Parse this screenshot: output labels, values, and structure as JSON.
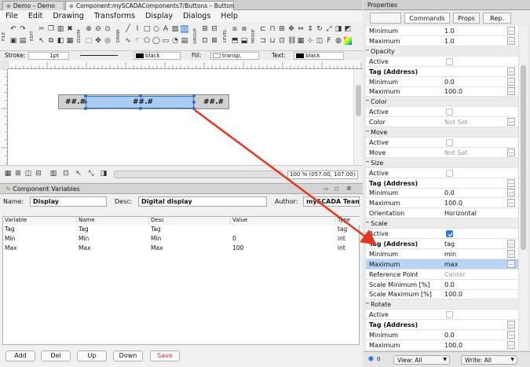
{
  "tabs": [
    {
      "label": "Demo – Demo"
    },
    {
      "label": "Component:mySCADAComponents7/Buttons – Button"
    }
  ],
  "menu": [
    "File",
    "Edit",
    "Drawing",
    "Transforms",
    "Display",
    "Dialogs",
    "Help"
  ],
  "toolbar": {
    "groups": [
      "FILE",
      "EDIT",
      "ZOOM",
      "DRAW",
      "GROUP",
      "LEVEL",
      "MODIF"
    ]
  },
  "propbar": {
    "stroke_label": "Stroke:",
    "stroke_value": "1pt",
    "stroke_color": "black",
    "fill_label": "Fill:",
    "fill_value": "transp.",
    "text_label": "Text:",
    "text_color": "black"
  },
  "canvas": {
    "left_text": "##.#",
    "center_text": "##.#",
    "right_text": "##.#"
  },
  "bottombar": {
    "zoom": "100 % (057.00, 107.00)"
  },
  "component_variables": {
    "title": "Component Variables",
    "name_label": "Name:",
    "name_value": "Display",
    "desc_label": "Desc:",
    "desc_value": "Digital display",
    "author_label": "Author:",
    "author_value": "mySCADA Team",
    "columns": [
      "Variable",
      "Name",
      "Desc",
      "Value",
      "Type"
    ],
    "rows": [
      {
        "variable": "Tag",
        "name": "Tag",
        "desc": "Tag",
        "value": "",
        "type": "tag"
      },
      {
        "variable": "Min",
        "name": "Min",
        "desc": "Min",
        "value": "0",
        "type": "int"
      },
      {
        "variable": "Max",
        "name": "Max",
        "desc": "Max",
        "value": "100",
        "type": "int"
      }
    ],
    "buttons": {
      "add": "Add",
      "del": "Del",
      "up": "Up",
      "down": "Down",
      "save": "Save"
    }
  },
  "properties": {
    "title": "Properties",
    "tabs": [
      "Commands",
      "Props",
      "Rep."
    ],
    "rows": [
      {
        "k": "Minimum",
        "v": "1.0",
        "dots": true
      },
      {
        "k": "Maximum",
        "v": "1.0",
        "dots": true
      },
      {
        "k": "Opacity",
        "section": true
      },
      {
        "k": "Active",
        "check": false
      },
      {
        "k": "Tag (Address)",
        "bold": true,
        "v": "",
        "dots": true
      },
      {
        "k": "Minimum",
        "v": "0.0",
        "dots": true
      },
      {
        "k": "Maximum",
        "v": "100.0",
        "dots": true
      },
      {
        "k": "Color",
        "section": true
      },
      {
        "k": "Active",
        "check": false
      },
      {
        "k": "Color",
        "v": "Not Set",
        "grey": true,
        "dots": true
      },
      {
        "k": "Move",
        "section": true
      },
      {
        "k": "Active",
        "check": false
      },
      {
        "k": "Move",
        "v": "Not Set",
        "grey": true,
        "dots": true
      },
      {
        "k": "Size",
        "section": true
      },
      {
        "k": "Active",
        "check": false
      },
      {
        "k": "Tag (Address)",
        "bold": true,
        "v": "",
        "dots": true
      },
      {
        "k": "Minimum",
        "v": "0.0",
        "dots": true
      },
      {
        "k": "Maximum",
        "v": "100.0",
        "dots": true
      },
      {
        "k": "Orientation",
        "v": "Horizontal"
      },
      {
        "k": "Scale",
        "section": true
      },
      {
        "k": "Active",
        "check": true
      },
      {
        "k": "Tag (Address)",
        "bold": true,
        "v": "tag",
        "dots": true
      },
      {
        "k": "Minimum",
        "v": "min",
        "dots": true
      },
      {
        "k": "Maximum",
        "v": "max",
        "dots": true,
        "selected": true
      },
      {
        "k": "Reference Point",
        "v": "Center",
        "grey": true
      },
      {
        "k": "Scale Minimum [%]",
        "v": "0.0"
      },
      {
        "k": "Scale Maximum [%]",
        "v": "100.0"
      },
      {
        "k": "Rotate",
        "section": true
      },
      {
        "k": "Active",
        "check": false
      },
      {
        "k": "Tag (Address)",
        "bold": true,
        "v": "",
        "dots": true
      },
      {
        "k": "Minimum",
        "v": "0.0",
        "dots": true
      },
      {
        "k": "Maximum",
        "v": "100.0",
        "dots": true
      }
    ],
    "footer": {
      "count": "0",
      "view": "View: All",
      "write": "Write: All"
    }
  },
  "colors": {
    "arrow": "#e8351f",
    "selection": "#a9ccf2",
    "accent": "#2d7be0"
  }
}
